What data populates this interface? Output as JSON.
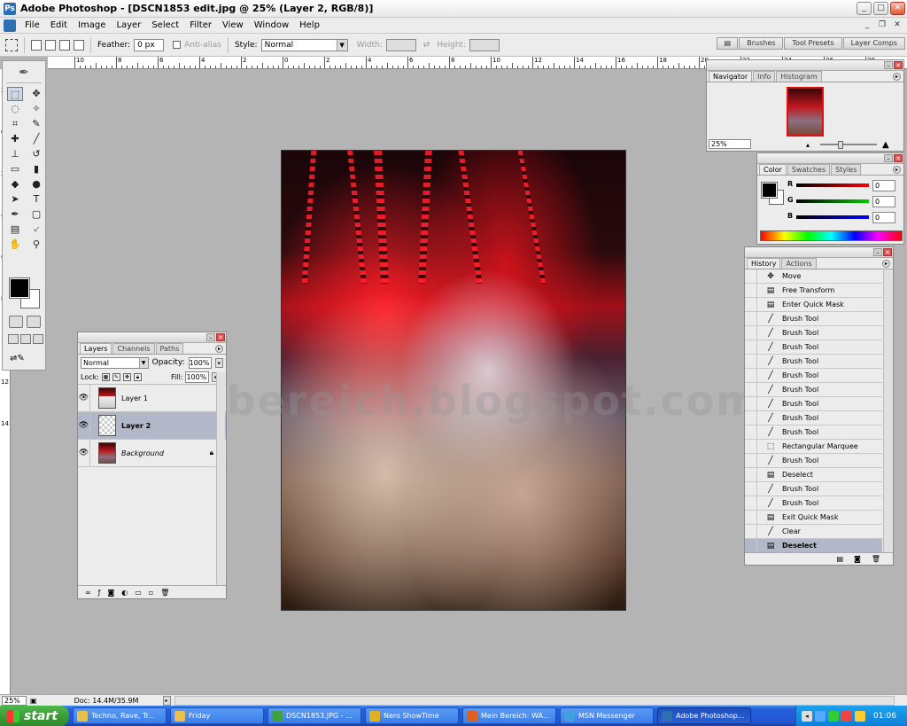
{
  "window": {
    "title": "Adobe Photoshop - [DSCN1853 edit.jpg @ 25% (Layer 2, RGB/8)]",
    "minimize": "_",
    "maximize": "□",
    "close": "✕",
    "doc_minimize": "_",
    "doc_restore": "❐",
    "doc_close": "✕"
  },
  "menubar": [
    "File",
    "Edit",
    "Image",
    "Layer",
    "Select",
    "Filter",
    "View",
    "Window",
    "Help"
  ],
  "options": {
    "feather_label": "Feather:",
    "feather_value": "0 px",
    "antialias_label": "Anti-alias",
    "style_label": "Style:",
    "style_value": "Normal",
    "width_label": "Width:",
    "height_label": "Height:",
    "well_tabs": [
      "Brushes",
      "Tool Presets",
      "Layer Comps"
    ]
  },
  "ruler": {
    "h_labels": [
      "10",
      "8",
      "6",
      "4",
      "2",
      "0",
      "2",
      "4",
      "6",
      "8",
      "10",
      "12",
      "14",
      "16",
      "18",
      "20",
      "22",
      "24",
      "26",
      "28"
    ],
    "v_labels": [
      "2",
      "0",
      "2",
      "4",
      "6",
      "8",
      "10",
      "12",
      "14"
    ]
  },
  "tools": {
    "icons": [
      "marquee-tool-icon",
      "move-tool-icon",
      "lasso-tool-icon",
      "magic-wand-icon",
      "crop-tool-icon",
      "slice-tool-icon",
      "healing-brush-icon",
      "brush-tool-icon",
      "clone-stamp-icon",
      "history-brush-icon",
      "eraser-tool-icon",
      "gradient-tool-icon",
      "blur-tool-icon",
      "dodge-tool-icon",
      "path-select-icon",
      "type-tool-icon",
      "pen-tool-icon",
      "shape-tool-icon",
      "notes-tool-icon",
      "eyedropper-icon",
      "hand-tool-icon",
      "zoom-tool-icon"
    ],
    "glyphs": [
      "⬚",
      "✥",
      "◌",
      "✧",
      "⌗",
      "✎",
      "✚",
      "╱",
      "⊥",
      "↺",
      "▭",
      "▮",
      "◆",
      "●",
      "➤",
      "T",
      "✒",
      "▢",
      "▤",
      "⸔",
      "✋",
      "⚲"
    ],
    "foreground_color": "#000000",
    "background_color": "#ffffff"
  },
  "canvas": {
    "watermark": "meinbereich.blogspot.com"
  },
  "layers_panel": {
    "tabs": [
      "Layers",
      "Channels",
      "Paths"
    ],
    "blend_mode": "Normal",
    "opacity_label": "Opacity:",
    "opacity_value": "100%",
    "lock_label": "Lock:",
    "fill_label": "Fill:",
    "fill_value": "100%",
    "layers": [
      {
        "name": "Layer 1",
        "visible": true,
        "selected": false
      },
      {
        "name": "Layer 2",
        "visible": true,
        "selected": true
      },
      {
        "name": "Background",
        "visible": true,
        "selected": false,
        "locked": true
      }
    ]
  },
  "navigator_panel": {
    "tabs": [
      "Navigator",
      "Info",
      "Histogram"
    ],
    "zoom": "25%"
  },
  "color_panel": {
    "tabs": [
      "Color",
      "Swatches",
      "Styles"
    ],
    "channels": [
      {
        "label": "R",
        "value": "0",
        "color": "#e02020"
      },
      {
        "label": "G",
        "value": "0",
        "color": "#20c020"
      },
      {
        "label": "B",
        "value": "0",
        "color": "#2030e0"
      }
    ]
  },
  "history_panel": {
    "tabs": [
      "History",
      "Actions"
    ],
    "items": [
      {
        "label": "Move",
        "icon": "move"
      },
      {
        "label": "Free Transform",
        "icon": "doc"
      },
      {
        "label": "Enter Quick Mask",
        "icon": "doc"
      },
      {
        "label": "Brush Tool",
        "icon": "brush"
      },
      {
        "label": "Brush Tool",
        "icon": "brush"
      },
      {
        "label": "Brush Tool",
        "icon": "brush"
      },
      {
        "label": "Brush Tool",
        "icon": "brush"
      },
      {
        "label": "Brush Tool",
        "icon": "brush"
      },
      {
        "label": "Brush Tool",
        "icon": "brush"
      },
      {
        "label": "Brush Tool",
        "icon": "brush"
      },
      {
        "label": "Brush Tool",
        "icon": "brush"
      },
      {
        "label": "Brush Tool",
        "icon": "brush"
      },
      {
        "label": "Rectangular Marquee",
        "icon": "marquee"
      },
      {
        "label": "Brush Tool",
        "icon": "brush"
      },
      {
        "label": "Deselect",
        "icon": "doc"
      },
      {
        "label": "Brush Tool",
        "icon": "brush"
      },
      {
        "label": "Brush Tool",
        "icon": "brush"
      },
      {
        "label": "Exit Quick Mask",
        "icon": "doc"
      },
      {
        "label": "Clear",
        "icon": "brush"
      },
      {
        "label": "Deselect",
        "icon": "doc",
        "selected": true
      }
    ]
  },
  "statusbar": {
    "zoom": "25%",
    "doc_info": "Doc: 14.4M/35.9M"
  },
  "taskbar": {
    "start_label": "start",
    "items": [
      {
        "label": "Techno, Rave, Tr...",
        "color": "#e8c050"
      },
      {
        "label": "Friday",
        "color": "#e8c050"
      },
      {
        "label": "DSCN1853.JPG - ...",
        "color": "#40a040"
      },
      {
        "label": "Nero ShowTime",
        "color": "#e0b020"
      },
      {
        "label": "Mein Bereich: WA...",
        "color": "#e06020"
      },
      {
        "label": "MSN Messenger",
        "color": "#40a0e0"
      },
      {
        "label": "Adobe Photoshop...",
        "color": "#2e6fb3",
        "active": true
      }
    ],
    "clock": "01:06"
  }
}
